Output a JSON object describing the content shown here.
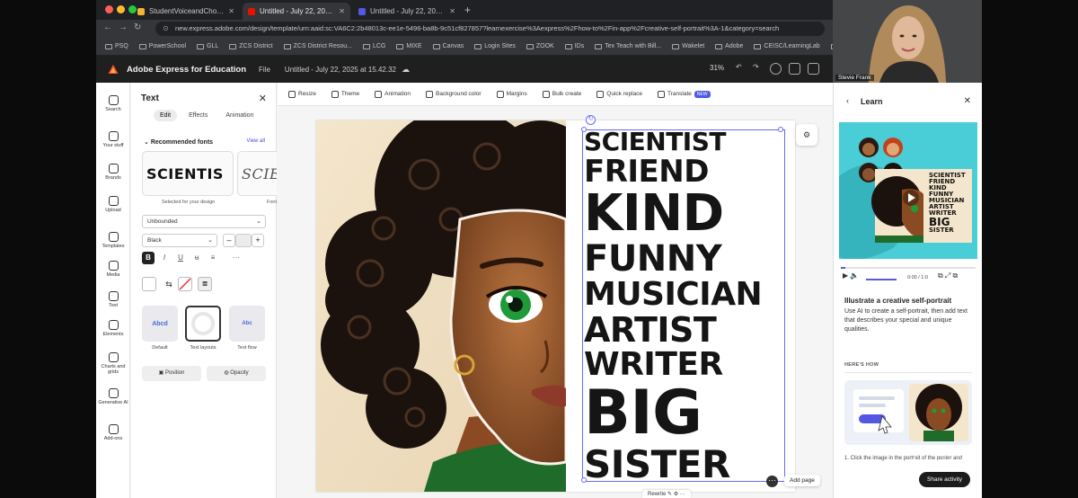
{
  "browser": {
    "tabs": [
      {
        "label": "StudentVoiceandChoice_Ad",
        "active": false
      },
      {
        "label": "Untitled - July 22, 2025 at 1",
        "active": true
      },
      {
        "label": "Untitled - July 22, 2025 at 1",
        "active": false
      }
    ],
    "url": "new.express.adobe.com/design/template/urn:aaid:sc:VA6C2:2b48013c-ee1e-5496-ba8b-9c51cf827857?learnexercise%3Aexpress%2Fhow-to%2Fin-app%2Fcreative-self-portrait%3A-1&category=search",
    "bookmarks": [
      "PSQ",
      "PowerSchool",
      "GLL",
      "ZCS District",
      "ZCS District Resou...",
      "LCG",
      "MIXE",
      "Canvas",
      "Login Sites",
      "ZOOK",
      "IDs",
      "Tex Teach with Bill...",
      "Wakelet",
      "Adobe",
      "CEISC/LearningLab",
      "Engagemen"
    ]
  },
  "app": {
    "name": "Adobe Express for Education",
    "file_menu": "File",
    "doc_title": "Untitled - July 22, 2025 at 15.42.32",
    "zoom": "31%"
  },
  "rail": [
    {
      "label": "Search",
      "icon": "search-icon"
    },
    {
      "label": "Your stuff",
      "icon": "folder-icon"
    },
    {
      "label": "Brands",
      "icon": "brand-icon"
    },
    {
      "label": "Upload",
      "icon": "upload-icon"
    },
    {
      "label": "Templates",
      "icon": "templates-icon"
    },
    {
      "label": "Media",
      "icon": "media-icon"
    },
    {
      "label": "Text",
      "icon": "text-icon"
    },
    {
      "label": "Elements",
      "icon": "elements-icon"
    },
    {
      "label": "Charts and grids",
      "icon": "chart-icon"
    },
    {
      "label": "Generative AI",
      "icon": "ai-icon"
    },
    {
      "label": "Add-ons",
      "icon": "addons-icon"
    }
  ],
  "text_panel": {
    "title": "Text",
    "tabs": [
      "Edit",
      "Effects",
      "Animation"
    ],
    "recommended": "Recommended fonts",
    "view_all": "View all",
    "font_samples": [
      "SCIENTIS",
      "SCIE"
    ],
    "font_caption_1": "Selected for your design",
    "font_caption_2": "Font",
    "font_family": "Unbounded",
    "font_weight": "Black",
    "minus": "–",
    "plus": "+",
    "bold": "B",
    "italic": "I",
    "underline": "U",
    "layouts": [
      {
        "label": "Default",
        "sample": "Abcd"
      },
      {
        "label": "Text layouts",
        "sample": ""
      },
      {
        "label": "Text flow",
        "sample": "Abc"
      }
    ],
    "position": "Position",
    "opacity": "Opacity"
  },
  "toolbar": [
    {
      "label": "Resize"
    },
    {
      "label": "Theme"
    },
    {
      "label": "Animation"
    },
    {
      "label": "Background color"
    },
    {
      "label": "Margins"
    },
    {
      "label": "Bulk create"
    },
    {
      "label": "Quick replace"
    },
    {
      "label": "Translate",
      "badge": "NEW"
    }
  ],
  "poster_words": [
    "SCIENTIST",
    "FRIEND",
    "KIND",
    "FUNNY",
    "MUSICIAN",
    "ARTIST",
    "WRITER",
    "BIG",
    "SISTER"
  ],
  "canvas": {
    "add_page": "Add page",
    "bottom_bar": "Rewrite"
  },
  "learn": {
    "title": "Learn",
    "video_time": "0:00 / 1:0",
    "mini_words": [
      "SCIENTIST",
      "FRIEND",
      "KIND",
      "FUNNY",
      "MUSICIAN",
      "ARTIST",
      "WRITER",
      "BIG",
      "SISTER"
    ],
    "heading": "Illustrate a creative self-portrait",
    "description": "Use AI to create a self-portrait, then add text that describes your special and unique qualities.",
    "how_label": "HERE'S HOW",
    "step_caption": "1. Click the image in the portrait of the poster and",
    "share": "Share activity",
    "watermark": "Powered by Zoom"
  },
  "webcam": {
    "name": "Stevie Frank"
  },
  "colors": {
    "accent": "#5258e4",
    "teal": "#3ec6cf",
    "chrome": "#2b2d31"
  }
}
